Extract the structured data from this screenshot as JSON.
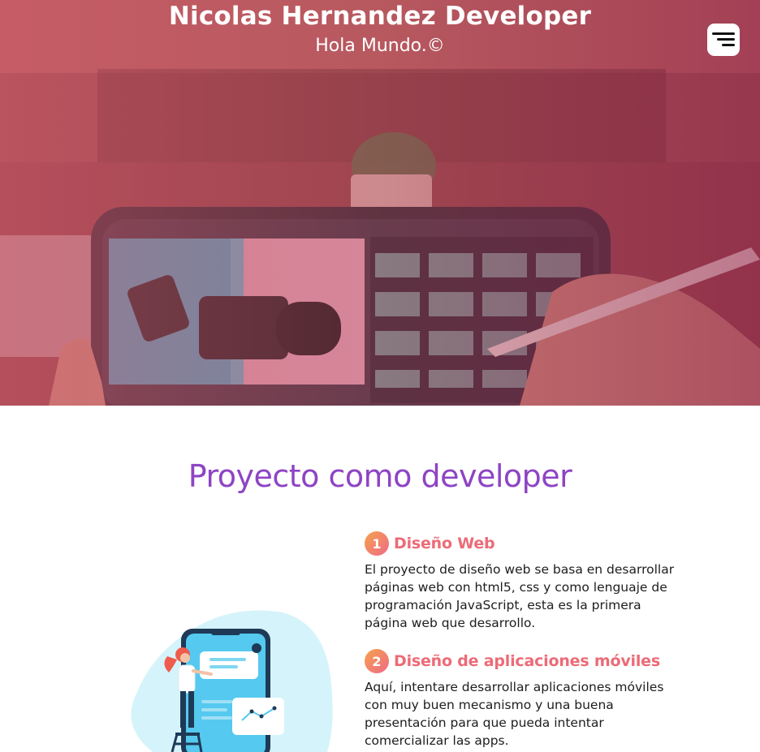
{
  "header": {
    "title": "Nicolas Hernandez Developer",
    "subtitle": "Hola Mundo.©"
  },
  "menu": {
    "icon": "hamburger-menu-icon"
  },
  "section": {
    "title": "Proyecto como developer",
    "illustration": "phone-with-woman-illustration",
    "items": [
      {
        "number": "1",
        "title": "Diseño Web",
        "text": "El proyecto de diseño web se basa en desarrollar páginas web con html5, css y como lenguaje de programación JavaScript, esta es la primera página web que desarrollo."
      },
      {
        "number": "2",
        "title": "Diseño de aplicaciones móviles",
        "text": "Aquí, intentare desarrollar aplicaciones móviles con muy buen mecanismo y una buena presentación para que pueda intentar comercializar las apps."
      }
    ]
  },
  "colors": {
    "accent_purple": "#8e44c4",
    "accent_coral": "#ec6b77",
    "badge_gradient_start": "#f6a24b",
    "badge_gradient_end": "#ee6a88"
  }
}
